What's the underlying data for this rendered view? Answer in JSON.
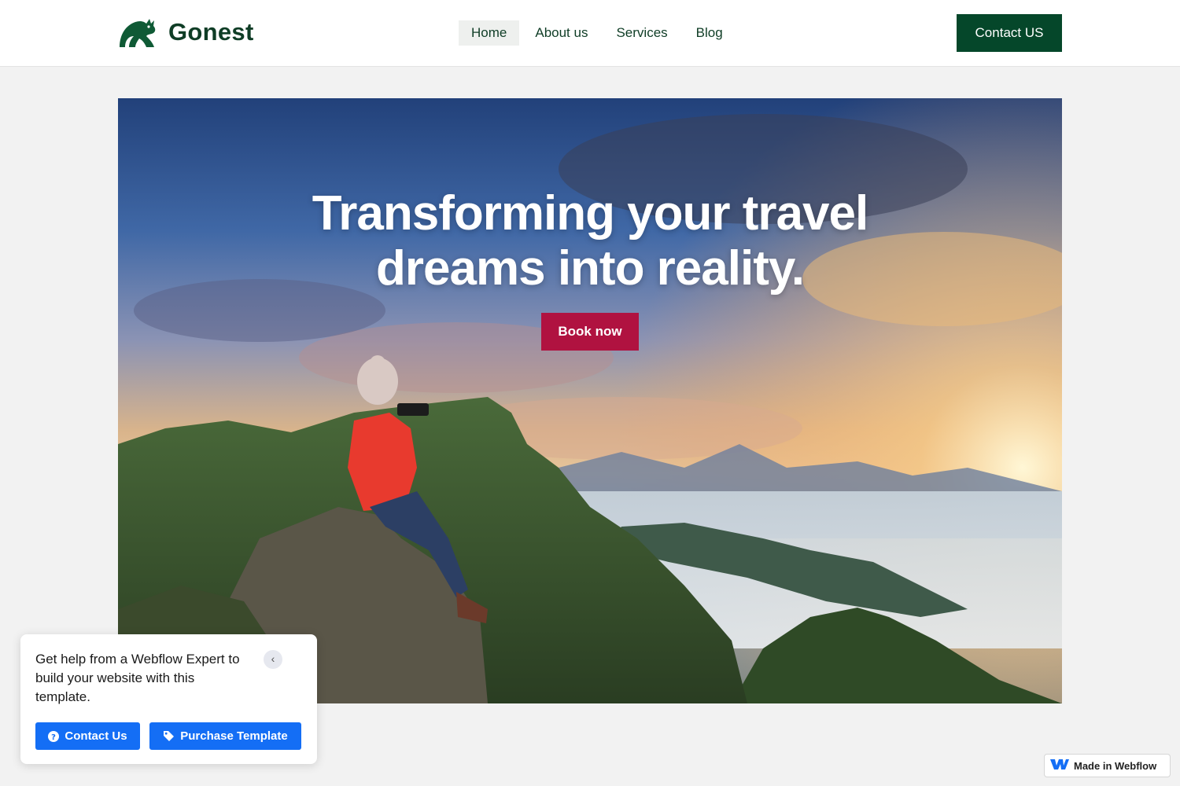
{
  "header": {
    "brand": "Gonest",
    "logo_icon": "kangaroo-icon",
    "nav": [
      {
        "label": "Home",
        "active": true
      },
      {
        "label": "About us",
        "active": false
      },
      {
        "label": "Services",
        "active": false
      },
      {
        "label": "Blog",
        "active": false
      }
    ],
    "cta_label": "Contact US"
  },
  "hero": {
    "title_line1": "Transforming your travel",
    "title_line2": "dreams into reality.",
    "button_label": "Book now",
    "image": "hiker-photographing-mountain-sunrise"
  },
  "help_popup": {
    "text": "Get help from a Webflow Expert to build your website with this template.",
    "collapse_icon": "chevron-left-icon",
    "contact_label": "Contact Us",
    "contact_icon": "question-circle-icon",
    "purchase_label": "Purchase Template",
    "purchase_icon": "tag-icon"
  },
  "badge": {
    "label": "Made in Webflow",
    "icon": "webflow-logo-icon"
  },
  "colors": {
    "brand_green": "#05472a",
    "book_button": "#b01240",
    "webflow_blue": "#146ef5",
    "page_bg": "#f2f2f2"
  }
}
